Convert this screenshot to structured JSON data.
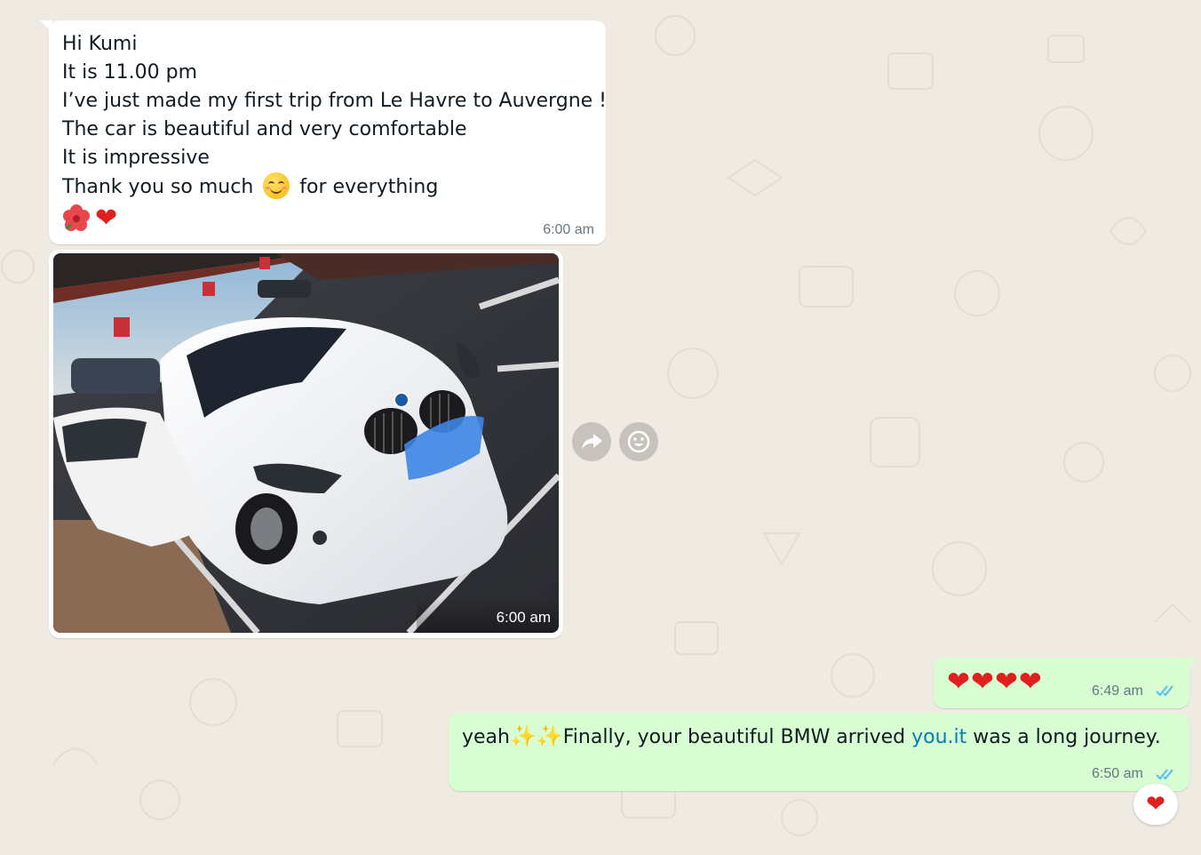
{
  "incoming_text": {
    "lines": [
      "Hi Kumi",
      "It is 11.00 pm",
      "I’ve just made my first trip from Le Havre to Auvergne !",
      "The car is beautiful and very comfortable",
      "It is impressive"
    ],
    "thanks_before": "Thank you so much",
    "thanks_after": "for everything",
    "time": "6:00 am"
  },
  "incoming_photo": {
    "time": "6:00 am",
    "icon": "bmw-car-photo"
  },
  "hover_actions": {
    "forward_icon": "forward-icon",
    "react_icon": "emoji-icon"
  },
  "outgoing_hearts": {
    "emoji": "❤❤❤❤",
    "time": "6:49 am",
    "status_icon": "double-check-icon"
  },
  "outgoing_text": {
    "before": "yeah",
    "sparkles": "✨✨",
    "middle": "Finally, your beautiful BMW arrived ",
    "link": "you.it",
    "after": " was a long journey.",
    "time": "6:50 am",
    "status_icon": "double-check-icon"
  },
  "reaction": {
    "emoji": "❤"
  },
  "colors": {
    "background": "#efeae2",
    "incoming": "#ffffff",
    "outgoing": "#d9fdd3",
    "read_ticks": "#53bdeb",
    "link": "#027eb5"
  }
}
